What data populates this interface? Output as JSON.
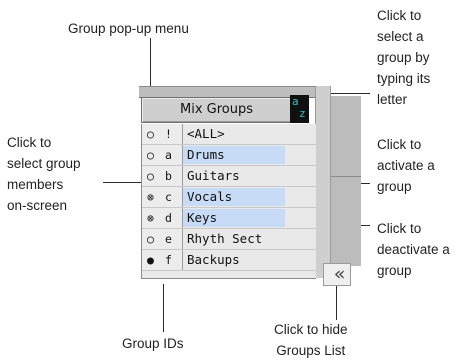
{
  "window": {
    "popup_label": "Mix Groups",
    "sort_top": "a",
    "sort_bottom": "z",
    "hide_button_glyph": "«",
    "rows": [
      {
        "status": "○",
        "id": "!",
        "name": "<ALL>",
        "active": false
      },
      {
        "status": "○",
        "id": "a",
        "name": "Drums",
        "active": true
      },
      {
        "status": "○",
        "id": "b",
        "name": "Guitars",
        "active": false
      },
      {
        "status": "⊗",
        "id": "c",
        "name": "Vocals",
        "active": true
      },
      {
        "status": "⊗",
        "id": "d",
        "name": "Keys",
        "active": true
      },
      {
        "status": "○",
        "id": "e",
        "name": "Rhyth Sect",
        "active": false
      },
      {
        "status": "●",
        "id": "f",
        "name": "Backups",
        "active": false
      }
    ]
  },
  "callouts": {
    "popup_menu": "Group pop-up menu",
    "select_letter": [
      "Click to",
      "select a",
      "group by",
      "typing its",
      "letter"
    ],
    "select_members": [
      "Click to",
      "select group",
      "members",
      "on-screen"
    ],
    "activate": [
      "Click to",
      "activate a",
      "group"
    ],
    "deactivate": [
      "Click to",
      "deactivate a",
      "group"
    ],
    "group_ids": "Group IDs",
    "hide_list": [
      "Click to hide",
      "Groups List"
    ]
  }
}
